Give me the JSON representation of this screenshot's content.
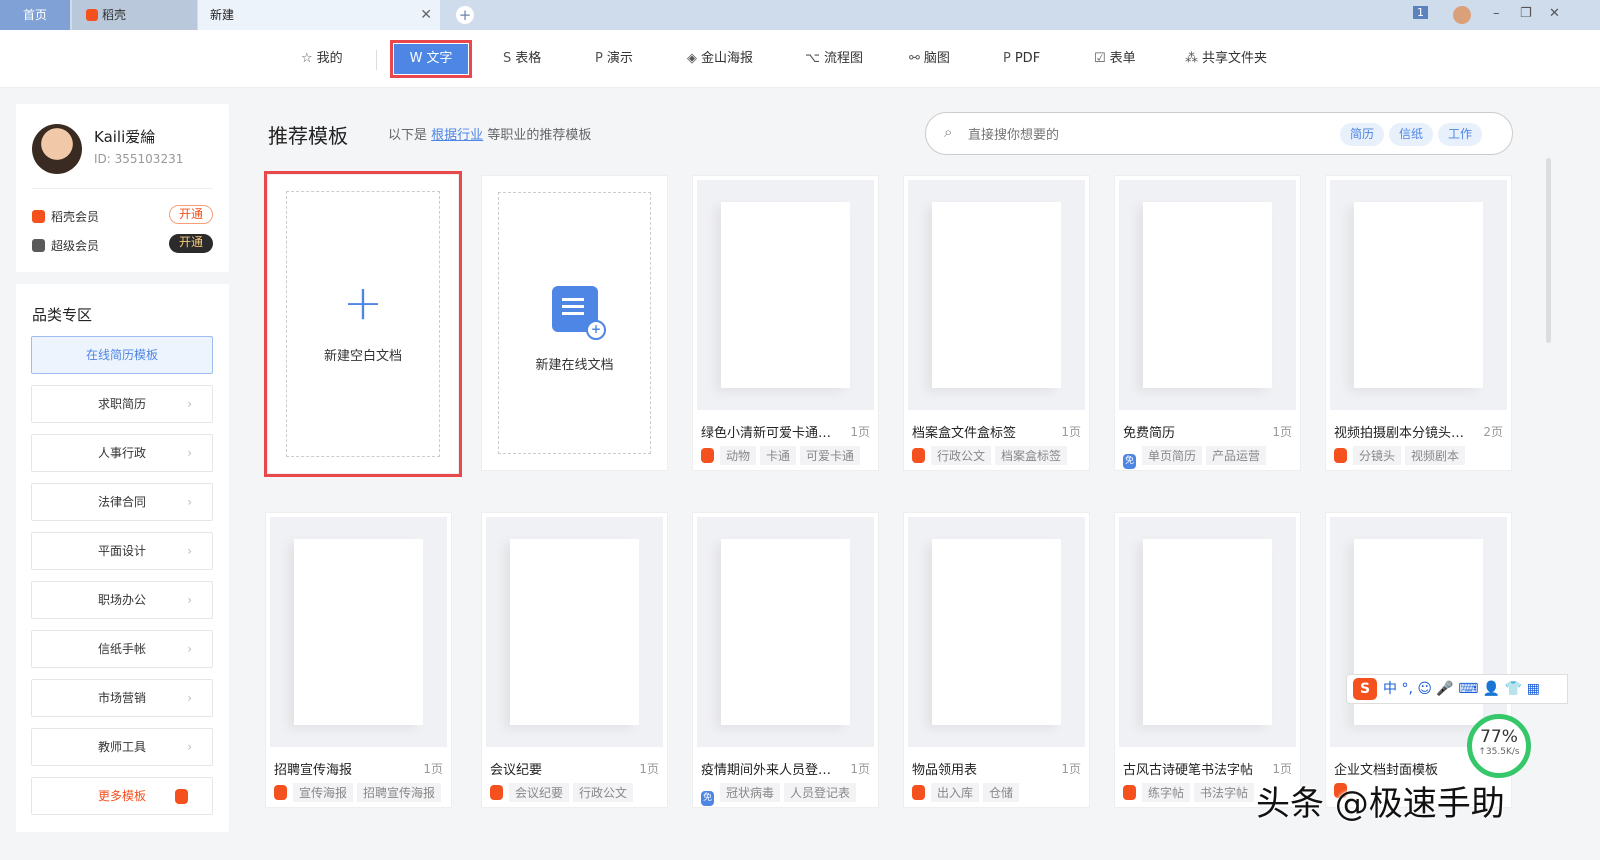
{
  "tabs": [
    {
      "label": "首页"
    },
    {
      "label": "稻壳"
    },
    {
      "label": "新建"
    }
  ],
  "window": {
    "notif_count": "1"
  },
  "nav": [
    {
      "label": "我的",
      "icon": "☆"
    },
    {
      "label": "文字",
      "icon": "W"
    },
    {
      "label": "表格",
      "icon": "S"
    },
    {
      "label": "演示",
      "icon": "P"
    },
    {
      "label": "金山海报",
      "icon": "◈"
    },
    {
      "label": "流程图",
      "icon": "⌥"
    },
    {
      "label": "脑图",
      "icon": "⚯"
    },
    {
      "label": "PDF",
      "icon": "P"
    },
    {
      "label": "表单",
      "icon": "☑"
    },
    {
      "label": "共享文件夹",
      "icon": "⁂"
    }
  ],
  "user": {
    "name": "Kaili爱綸",
    "id": "ID: 355103231",
    "members": [
      {
        "label": "稻壳会员",
        "action": "开通"
      },
      {
        "label": "超级会员",
        "action": "开通"
      }
    ]
  },
  "categories": {
    "title": "品类专区",
    "items": [
      "在线简历模板",
      "求职简历",
      "人事行政",
      "法律合同",
      "平面设计",
      "职场办公",
      "信纸手帐",
      "市场营销",
      "教师工具"
    ],
    "more": "更多模板"
  },
  "header": {
    "title": "推荐模板",
    "sub_prefix": "以下是",
    "sub_link": "根据行业",
    "sub_suffix": "等职业的推荐模板"
  },
  "search": {
    "placeholder": "直接搜你想要的",
    "chips": [
      "简历",
      "信纸",
      "工作"
    ]
  },
  "new_blank": "新建空白文档",
  "new_online": "新建在线文档",
  "templates": [
    {
      "name": "绿色小清新可爱卡通动...",
      "pages": "1页",
      "badge": "dk",
      "tags": [
        "动物",
        "卡通",
        "可爱卡通"
      ]
    },
    {
      "name": "档案盒文件盒标签",
      "pages": "1页",
      "badge": "dk",
      "tags": [
        "行政公文",
        "档案盒标签"
      ]
    },
    {
      "name": "免费简历",
      "pages": "1页",
      "badge": "免",
      "tags": [
        "单页简历",
        "产品运营"
      ]
    },
    {
      "name": "视频拍摄剧本分镜头脚...",
      "pages": "2页",
      "badge": "dk",
      "tags": [
        "分镜头",
        "视频剧本"
      ]
    },
    {
      "name": "招聘宣传海报",
      "pages": "1页",
      "badge": "dk",
      "tags": [
        "宣传海报",
        "招聘宣传海报"
      ]
    },
    {
      "name": "会议纪要",
      "pages": "1页",
      "badge": "dk",
      "tags": [
        "会议纪要",
        "行政公文"
      ]
    },
    {
      "name": "疫情期间外来人员登记...",
      "pages": "1页",
      "badge": "免",
      "tags": [
        "冠状病毒",
        "人员登记表"
      ]
    },
    {
      "name": "物品领用表",
      "pages": "1页",
      "badge": "dk",
      "tags": [
        "出入库",
        "仓储"
      ]
    },
    {
      "name": "古风古诗硬笔书法字帖",
      "pages": "1页",
      "badge": "dk",
      "tags": [
        "练字帖",
        "书法字帖"
      ]
    },
    {
      "name": "企业文档封面模板",
      "pages": "",
      "badge": "dk",
      "tags": []
    }
  ],
  "ime": {
    "label": "中 °, ☺ 🎤 ⌨ 👤 👕 ▦"
  },
  "net": {
    "percent": "77%",
    "speed": "↑35.5K/s"
  },
  "watermark": "头条 @极速手助",
  "colors": {
    "accent": "#4d86e4",
    "highlight": "#e8474c",
    "docer": "#f4511e"
  }
}
